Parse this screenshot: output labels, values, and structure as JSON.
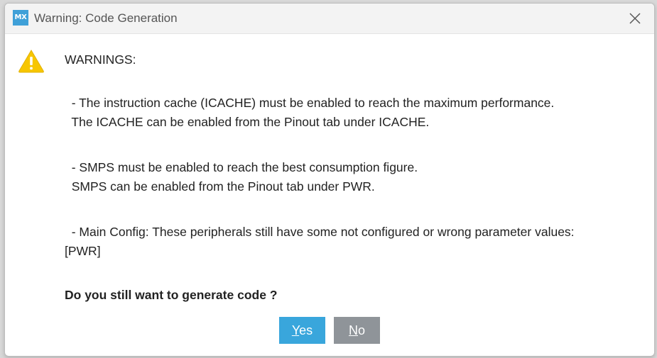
{
  "window": {
    "app_icon_text": "MX",
    "title": "Warning: Code Generation",
    "close_icon": "close-icon"
  },
  "dialog": {
    "icon": "warning-triangle-icon",
    "heading": "WARNINGS:",
    "warnings": [
      {
        "line1": "  - The instruction cache (ICACHE) must be enabled to reach the maximum performance.",
        "line2": "  The ICACHE can be enabled from the Pinout tab under ICACHE."
      },
      {
        "line1": "  - SMPS must be enabled to reach the best consumption figure.",
        "line2": "  SMPS can be enabled from the Pinout tab under PWR."
      },
      {
        "line1": "  - Main Config: These peripherals still have some not configured or wrong parameter values:",
        "line2": "[PWR]"
      }
    ],
    "question": "Do you still want to generate code ?"
  },
  "buttons": {
    "yes": {
      "mnemonic": "Y",
      "rest": "es"
    },
    "no": {
      "mnemonic": "N",
      "rest": "o"
    }
  },
  "colors": {
    "yes_button": "#39a6dc",
    "no_button": "#8f9499",
    "warning_icon": "#f7c600",
    "app_icon": "#3fa0d8"
  }
}
